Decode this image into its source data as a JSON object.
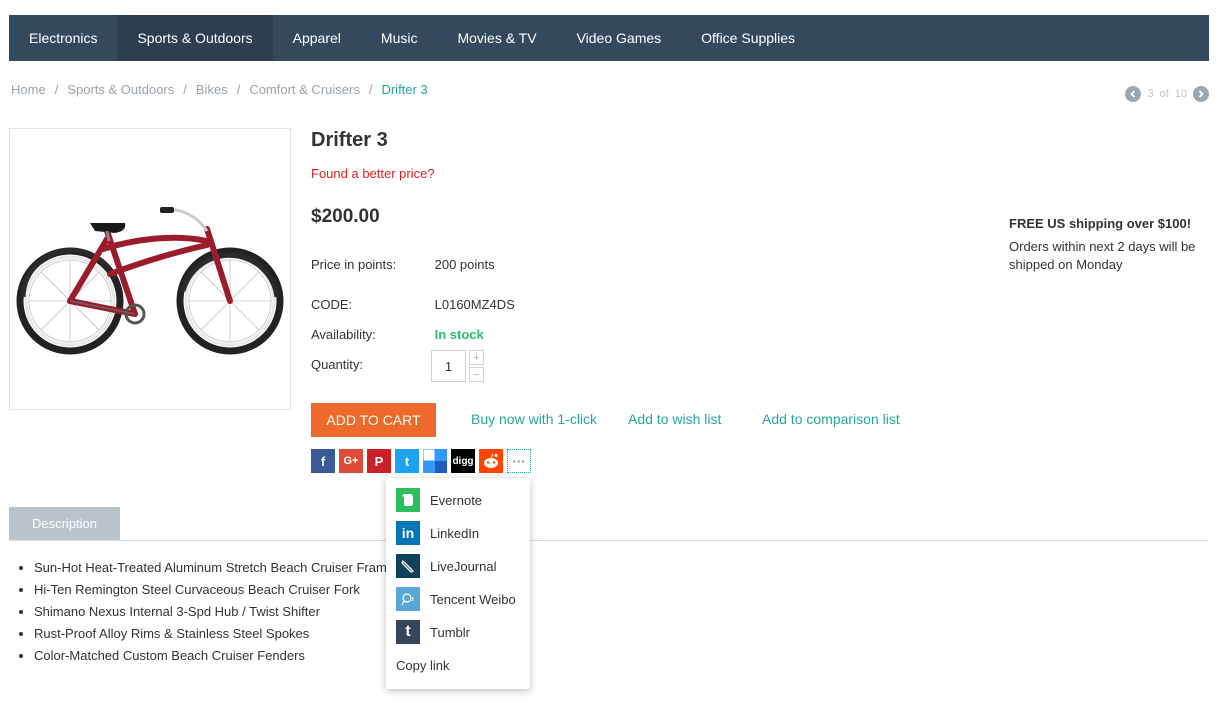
{
  "nav": {
    "items": [
      {
        "label": "Electronics"
      },
      {
        "label": "Sports & Outdoors"
      },
      {
        "label": "Apparel"
      },
      {
        "label": "Music"
      },
      {
        "label": "Movies & TV"
      },
      {
        "label": "Video Games"
      },
      {
        "label": "Office Supplies"
      }
    ],
    "active": "Sports & Outdoors"
  },
  "breadcrumb": {
    "items": [
      "Home",
      "Sports & Outdoors",
      "Bikes",
      "Comfort & Cruisers",
      "Drifter 3"
    ],
    "separator": "/"
  },
  "pager": {
    "current": "3",
    "of_label": "of",
    "total": "10"
  },
  "product": {
    "title": "Drifter 3",
    "better_price_link": "Found a better price?",
    "price": "$200.00",
    "points_label": "Price in points:",
    "points_value": "200 points",
    "code_label": "CODE:",
    "code_value": "L0160MZ4DS",
    "availability_label": "Availability:",
    "availability_value": "In stock",
    "quantity_label": "Quantity:",
    "quantity_value": "1",
    "qty_plus": "+",
    "qty_minus": "−"
  },
  "actions": {
    "add_to_cart": "ADD TO CART",
    "buy_now": "Buy now with 1-click",
    "wish_list": "Add to wish list",
    "comparison": "Add to comparison list"
  },
  "share_buttons": [
    {
      "name": "facebook",
      "glyph": "f",
      "color": "#3b5998"
    },
    {
      "name": "google-plus",
      "glyph": "G+",
      "color": "#dd4b39"
    },
    {
      "name": "pinterest",
      "glyph": "P",
      "color": "#cb2027"
    },
    {
      "name": "twitter",
      "glyph": "t",
      "color": "#1da1f2"
    },
    {
      "name": "delicious",
      "glyph": "",
      "color": "#3399ff"
    },
    {
      "name": "digg",
      "glyph": "digg",
      "color": "#000000"
    },
    {
      "name": "reddit",
      "glyph": "r",
      "color": "#ff4500"
    },
    {
      "name": "more",
      "glyph": "···",
      "color": "#ffffff"
    }
  ],
  "shipping": {
    "title": "FREE US shipping over $100!",
    "text": "Orders within next 2 days will be shipped on Monday"
  },
  "tabs": {
    "description": "Description"
  },
  "description_items": [
    "Sun-Hot Heat-Treated Aluminum Stretch Beach Cruiser Frame",
    "Hi-Ten Remington Steel Curvaceous Beach Cruiser Fork",
    "Shimano Nexus Internal 3-Spd Hub / Twist Shifter",
    "Rust-Proof Alloy Rims & Stainless Steel Spokes",
    "Color-Matched Custom Beach Cruiser Fenders"
  ],
  "share_dropdown": {
    "items": [
      {
        "label": "Evernote",
        "icon": "evernote-icon",
        "color": "#2dbe60"
      },
      {
        "label": "LinkedIn",
        "icon": "linkedin-icon",
        "color": "#0077b5"
      },
      {
        "label": "LiveJournal",
        "icon": "livejournal-icon",
        "color": "#0d425a"
      },
      {
        "label": "Tencent Weibo",
        "icon": "tencent-weibo-icon",
        "color": "#5ba6d6"
      },
      {
        "label": "Tumblr",
        "icon": "tumblr-icon",
        "color": "#35465c"
      }
    ],
    "copy_link": "Copy link"
  },
  "colors": {
    "nav_bg": "#35495e",
    "accent": "#26a69a",
    "cart_button": "#ed6a2b",
    "in_stock": "#2bbd6b",
    "alert": "#e02020"
  }
}
